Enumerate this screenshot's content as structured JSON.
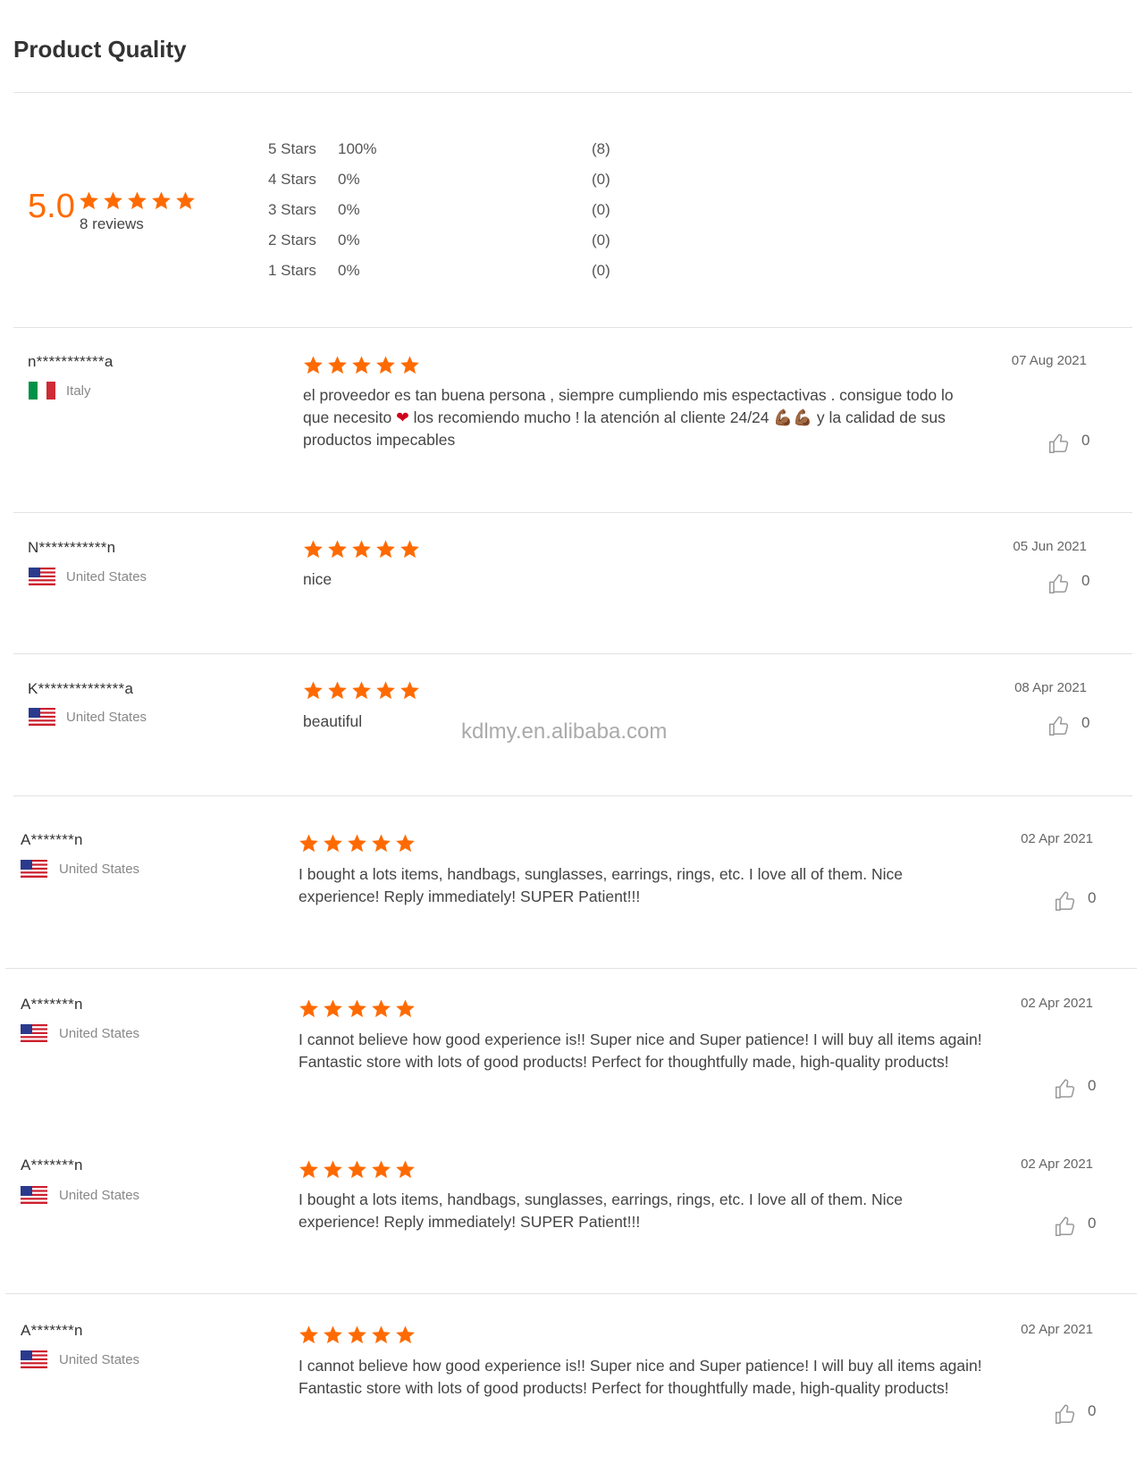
{
  "header": {
    "title": "Product Quality"
  },
  "summary": {
    "score": "5.0",
    "rating": 5,
    "reviews_label": "8 reviews",
    "distribution": [
      {
        "label": "5  Stars",
        "percent": "100%",
        "count": "(8)"
      },
      {
        "label": "4  Stars",
        "percent": "0%",
        "count": "(0)"
      },
      {
        "label": "3  Stars",
        "percent": "0%",
        "count": "(0)"
      },
      {
        "label": "2  Stars",
        "percent": "0%",
        "count": "(0)"
      },
      {
        "label": "1  Stars",
        "percent": "0%",
        "count": "(0)"
      }
    ]
  },
  "colors": {
    "accent": "#ff6a00",
    "divider": "#e2e2e2"
  },
  "icons": {
    "star": "star-icon",
    "like": "thumbs-up-icon",
    "flag_it": "italy-flag-icon",
    "flag_us": "us-flag-icon"
  },
  "reviews": [
    {
      "name": "n***********a",
      "country": "Italy",
      "flag": "it",
      "rating": 5,
      "text_before": "el proveedor es tan buena persona , siempre cumpliendo mis espectactivas . consigue todo lo que necesito ",
      "text_emoji1": "❤",
      "text_middle": " los recomiendo mucho ! la atención al cliente 24/24 ",
      "text_emoji2": "💪🏾💪🏾",
      "text_after": " y la calidad de sus productos impecables",
      "date": "07 Aug 2021",
      "likes": "0"
    },
    {
      "name": "N***********n",
      "country": "United States",
      "flag": "us",
      "rating": 5,
      "text": "nice",
      "date": "05 Jun 2021",
      "likes": "0"
    },
    {
      "name": "K**************a",
      "country": "United States",
      "flag": "us",
      "rating": 5,
      "text": "beautiful",
      "date": "08 Apr 2021",
      "likes": "0"
    },
    {
      "name": "A*******n",
      "country": "United States",
      "flag": "us",
      "rating": 5,
      "text": "I bought a lots items, handbags, sunglasses, earrings, rings, etc. I love all of them. Nice experience! Reply immediately!  SUPER Patient!!!",
      "date": "02 Apr 2021",
      "likes": "0"
    },
    {
      "name": "A*******n",
      "country": "United States",
      "flag": "us",
      "rating": 5,
      "text": "I cannot believe how good experience is!! Super nice and Super patience! I will buy all items again! Fantastic store with lots of good products! Perfect for thoughtfully made, high-quality products!",
      "date": "02 Apr 2021",
      "likes": "0"
    },
    {
      "name": "A*******n",
      "country": "United States",
      "flag": "us",
      "rating": 5,
      "text": "I bought a lots items, handbags, sunglasses, earrings, rings, etc. I love all of them. Nice experience! Reply immediately!  SUPER Patient!!!",
      "date": "02 Apr 2021",
      "likes": "0"
    },
    {
      "name": "A*******n",
      "country": "United States",
      "flag": "us",
      "rating": 5,
      "text": "I cannot believe how good experience is!! Super nice and Super patience! I will buy all items again! Fantastic store with lots of good products! Perfect for thoughtfully made, high-quality products!",
      "date": "02 Apr 2021",
      "likes": "0"
    }
  ],
  "watermark": "kdlmy.en.alibaba.com"
}
